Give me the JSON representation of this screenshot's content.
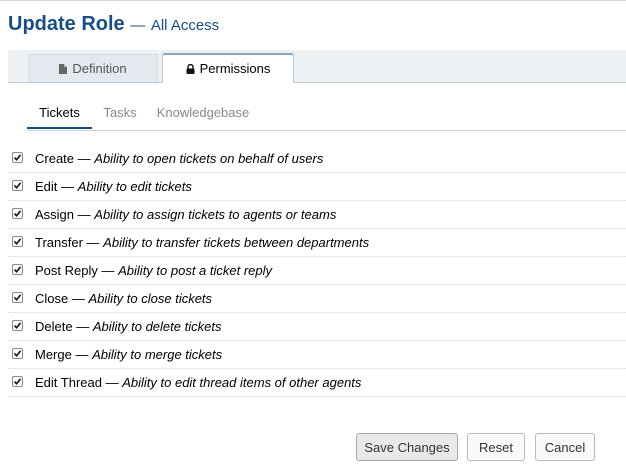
{
  "header": {
    "title": "Update Role",
    "separator": "—",
    "subtitle": "All Access"
  },
  "tabs": [
    {
      "label": "Definition",
      "icon": "file-icon",
      "active": false
    },
    {
      "label": "Permissions",
      "icon": "lock-icon",
      "active": true
    }
  ],
  "subtabs": [
    {
      "label": "Tickets",
      "active": true
    },
    {
      "label": "Tasks",
      "active": false
    },
    {
      "label": "Knowledgebase",
      "active": false
    }
  ],
  "permissions": [
    {
      "name": "Create",
      "sep": "—",
      "desc": "Ability to open tickets on behalf of users",
      "checked": true
    },
    {
      "name": "Edit",
      "sep": "—",
      "desc": "Ability to edit tickets",
      "checked": true
    },
    {
      "name": "Assign",
      "sep": "—",
      "desc": "Ability to assign tickets to agents or teams",
      "checked": true
    },
    {
      "name": "Transfer",
      "sep": "—",
      "desc": "Ability to transfer tickets between departments",
      "checked": true
    },
    {
      "name": "Post Reply",
      "sep": "—",
      "desc": "Ability to post a ticket reply",
      "checked": true
    },
    {
      "name": "Close",
      "sep": "—",
      "desc": "Ability to close tickets",
      "checked": true
    },
    {
      "name": "Delete",
      "sep": "—",
      "desc": "Ability to delete tickets",
      "checked": true
    },
    {
      "name": "Merge",
      "sep": "—",
      "desc": "Ability to merge tickets",
      "checked": true
    },
    {
      "name": "Edit Thread",
      "sep": "—",
      "desc": "Ability to edit thread items of other agents",
      "checked": true
    }
  ],
  "buttons": {
    "save": "Save Changes",
    "reset": "Reset",
    "cancel": "Cancel"
  },
  "colors": {
    "accent": "#184e81"
  }
}
